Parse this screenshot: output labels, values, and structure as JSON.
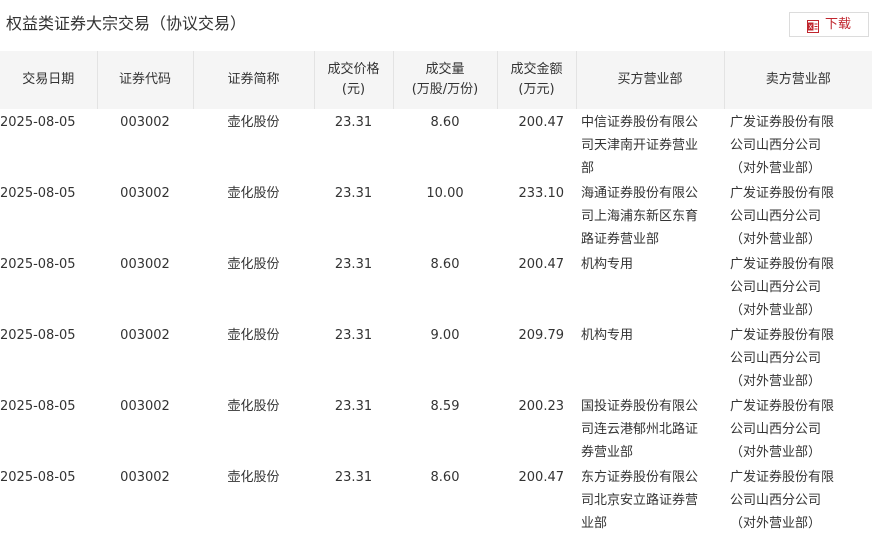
{
  "header": {
    "title": "权益类证券大宗交易（协议交易）",
    "download_label": "下载",
    "download_icon": "excel-icon",
    "accent_color": "#c0262e"
  },
  "table": {
    "columns": [
      {
        "lines": [
          "交易日期"
        ]
      },
      {
        "lines": [
          "证券代码"
        ]
      },
      {
        "lines": [
          "证券简称"
        ]
      },
      {
        "lines": [
          "成交价格",
          "(元)"
        ]
      },
      {
        "lines": [
          "成交量",
          "(万股/万份)"
        ]
      },
      {
        "lines": [
          "成交金额",
          "(万元)"
        ]
      },
      {
        "lines": [
          "买方营业部"
        ]
      },
      {
        "lines": [
          "卖方营业部"
        ]
      }
    ],
    "rows": [
      {
        "date": "2025-08-05",
        "code": "003002",
        "name": "壶化股份",
        "price": "23.31",
        "volume": "8.60",
        "amount": "200.47",
        "buyer": "中信证券股份有限公司天津南开证券营业部",
        "seller": "广发证券股份有限公司山西分公司（对外营业部）"
      },
      {
        "date": "2025-08-05",
        "code": "003002",
        "name": "壶化股份",
        "price": "23.31",
        "volume": "10.00",
        "amount": "233.10",
        "buyer": "海通证券股份有限公司上海浦东新区东育路证券营业部",
        "seller": "广发证券股份有限公司山西分公司（对外营业部）"
      },
      {
        "date": "2025-08-05",
        "code": "003002",
        "name": "壶化股份",
        "price": "23.31",
        "volume": "8.60",
        "amount": "200.47",
        "buyer": "机构专用",
        "seller": "广发证券股份有限公司山西分公司（对外营业部）"
      },
      {
        "date": "2025-08-05",
        "code": "003002",
        "name": "壶化股份",
        "price": "23.31",
        "volume": "9.00",
        "amount": "209.79",
        "buyer": "机构专用",
        "seller": "广发证券股份有限公司山西分公司（对外营业部）"
      },
      {
        "date": "2025-08-05",
        "code": "003002",
        "name": "壶化股份",
        "price": "23.31",
        "volume": "8.59",
        "amount": "200.23",
        "buyer": "国投证券股份有限公司连云港郁州北路证券营业部",
        "seller": "广发证券股份有限公司山西分公司（对外营业部）"
      },
      {
        "date": "2025-08-05",
        "code": "003002",
        "name": "壶化股份",
        "price": "23.31",
        "volume": "8.60",
        "amount": "200.47",
        "buyer": "东方证券股份有限公司北京安立路证券营业部",
        "seller": "广发证券股份有限公司山西分公司（对外营业部）"
      }
    ]
  }
}
